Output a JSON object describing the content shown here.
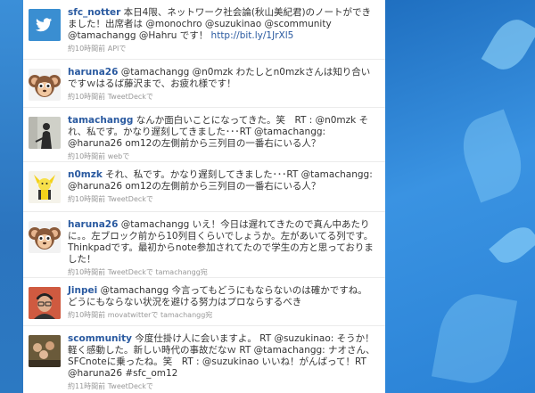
{
  "tweets": [
    {
      "user": "sfc_notter",
      "avatar": "twitter-bird",
      "text": "本日4限、ネットワーク社会論(秋山美紀君)のノートができました！出席者は @monochro @suzukinao @scommunity @tamachangg @Hahru です！",
      "link": "http://bit.ly/1JrXl5",
      "meta": "約10時間前 APIで"
    },
    {
      "user": "haruna26",
      "avatar": "monkey-mascot",
      "text": "@tamachangg @n0mzk わたしとn0mzkさんは知り合いですｗはるば藤沢まで、お疲れ様です！",
      "meta": "約10時間前 TweetDeckで"
    },
    {
      "user": "tamachangg",
      "avatar": "silhouette-photo",
      "text": "なんか面白いことになってきた。笑　RT : @n0mzk それ、私です。かなり遅刻してきました･･･RT @tamachangg: @haruna26 om12の左側前から三列目の一番右にいる人？",
      "meta": "約10時間前 webで"
    },
    {
      "user": "n0mzk",
      "avatar": "yellow-character",
      "text": "それ、私です。かなり遅刻してきました･･･RT @tamachangg: @haruna26 om12の左側前から三列目の一番右にいる人？",
      "meta": "約10時間前 TweetDeckで"
    },
    {
      "user": "haruna26",
      "avatar": "monkey-mascot",
      "text": "@tamachangg いえ！今日は遅れてきたので真ん中あたりに。。左ブロック前から10列目くらいでしょうか。左があいてる列です。Thinkpadです。最初からnote参加されてたので学生の方と思っておりました！",
      "meta": "約10時間前 TweetDeckで tamachangg宛"
    },
    {
      "user": "Jinpei",
      "avatar": "man-portrait",
      "text": "@tamachangg 今言ってもどうにもならないのは確かですね。どうにもならない状況を避ける努力はプロならするべき",
      "meta": "約10時間前 movatwitterで tamachangg宛"
    },
    {
      "user": "scommunity",
      "avatar": "group-photo",
      "text": "今度仕掛け人に会いますよ。 RT @suzukinao: そうか！軽く感動した。新しい時代の事故だなｗ RT @tamachangg: ナオさん、SFCnoteに乗ったね。笑　RT : @suzukinao いいね！がんばって！RT @haruna26 #sfc_om12",
      "meta": "約11時間前 TweetDeckで"
    }
  ]
}
